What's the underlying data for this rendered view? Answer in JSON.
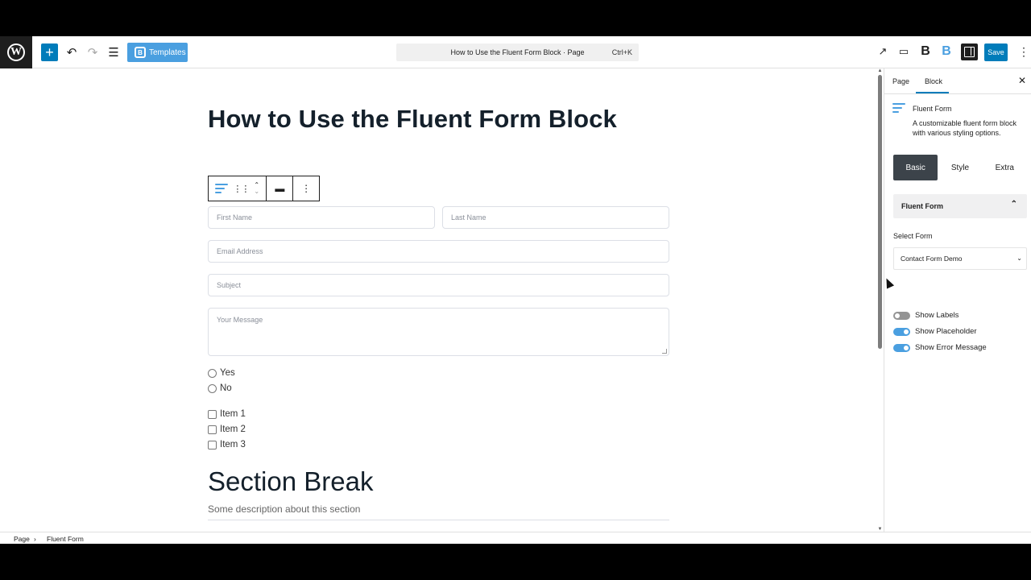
{
  "toolbar": {
    "templates_label": "Templates",
    "command_title": "How to Use the Fluent Form Block · Page",
    "command_shortcut": "Ctrl+K",
    "save_label": "Save"
  },
  "editor": {
    "page_title": "How to Use the Fluent Form Block",
    "form": {
      "first_name_placeholder": "First Name",
      "last_name_placeholder": "Last Name",
      "email_placeholder": "Email Address",
      "subject_placeholder": "Subject",
      "message_placeholder": "Your Message",
      "radio_options": [
        "Yes",
        "No"
      ],
      "checkbox_options": [
        "Item 1",
        "Item 2",
        "Item 3"
      ]
    },
    "section_break": {
      "title": "Section Break",
      "description": "Some description about this section"
    }
  },
  "sidebar": {
    "tabs": [
      "Page",
      "Block"
    ],
    "active_tab": "Block",
    "block_name": "Fluent Form",
    "block_description": "A customizable fluent form block with various styling options.",
    "settings_tabs": [
      "Basic",
      "Style",
      "Extra"
    ],
    "active_settings_tab": "Basic",
    "panel_title": "Fluent Form",
    "select_form_label": "Select Form",
    "selected_form": "Contact Form Demo",
    "toggles": [
      {
        "label": "Show Labels",
        "on": false
      },
      {
        "label": "Show Placeholder",
        "on": true
      },
      {
        "label": "Show Error Message",
        "on": true
      }
    ]
  },
  "breadcrumb": [
    "Page",
    "Fluent Form"
  ],
  "colors": {
    "accent": "#007cba",
    "brand": "#4a9fe0"
  }
}
